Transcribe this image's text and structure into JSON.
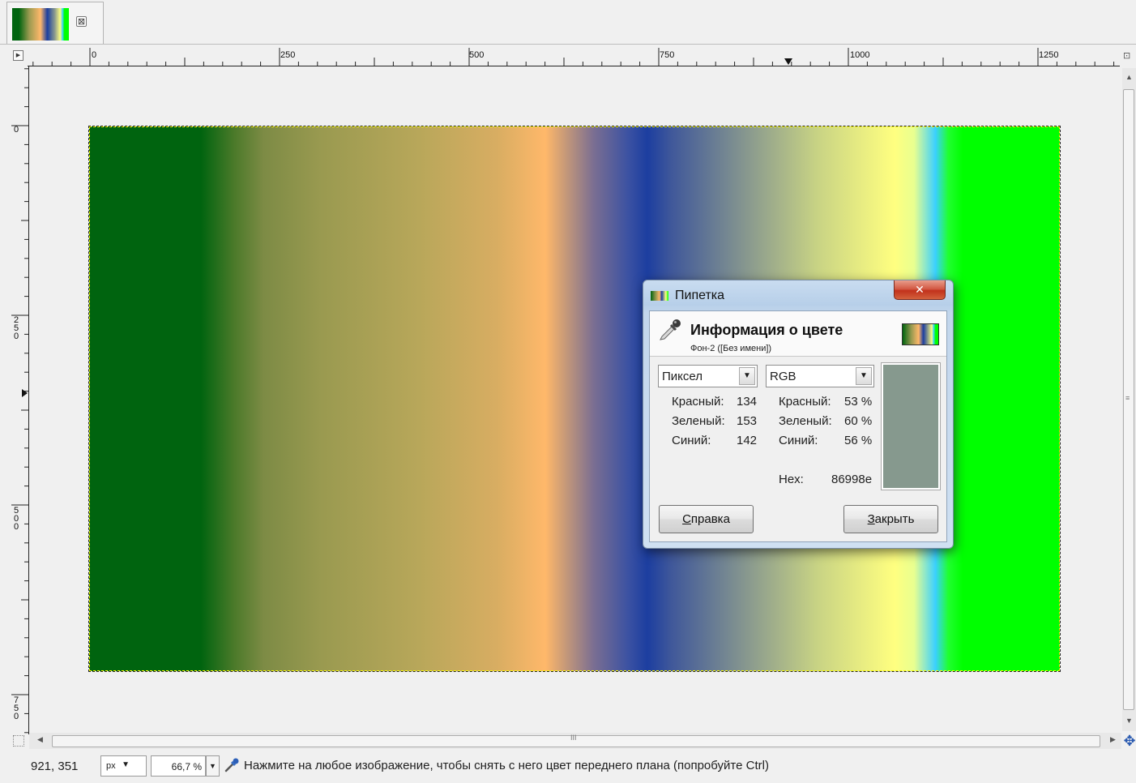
{
  "tab": {
    "close_glyph": "⊠"
  },
  "rulers": {
    "horizontal_labels": [
      "0",
      "250",
      "500",
      "750",
      "1000",
      "1250"
    ],
    "vertical_labels": [
      "0",
      "250",
      "500",
      "750"
    ]
  },
  "dialog": {
    "title": "Пипетка",
    "close_glyph": "✕",
    "heading": "Информация о цвете",
    "subheading": "Фон-2 ([Без имени])",
    "left_mode": "Пиксел",
    "right_mode": "RGB",
    "pixel_values": [
      {
        "label": "Красный:",
        "value": "134"
      },
      {
        "label": "Зеленый:",
        "value": "153"
      },
      {
        "label": "Синий:",
        "value": "142"
      }
    ],
    "rgb_values": [
      {
        "label": "Красный:",
        "value": "53 %"
      },
      {
        "label": "Зеленый:",
        "value": "60 %"
      },
      {
        "label": "Синий:",
        "value": "56 %"
      }
    ],
    "hex_label": "Hex:",
    "hex_value": "86998e",
    "swatch_color": "#86998e",
    "help_button": {
      "first": "С",
      "rest": "правка"
    },
    "close_button": {
      "first": "З",
      "rest": "акрыть"
    }
  },
  "statusbar": {
    "coords": "921, 351",
    "unit": "px",
    "zoom": "66,7 %",
    "message": "Нажмите на любое изображение, чтобы снять с него цвет переднего плана (попробуйте Ctrl)"
  },
  "scrollbars": {
    "grip": "III",
    "grip_v": "≡"
  },
  "icons": {
    "tab_thumbnail": "image-thumbnail-icon",
    "picker": "color-picker-icon",
    "navigate": "navigate-icon"
  }
}
